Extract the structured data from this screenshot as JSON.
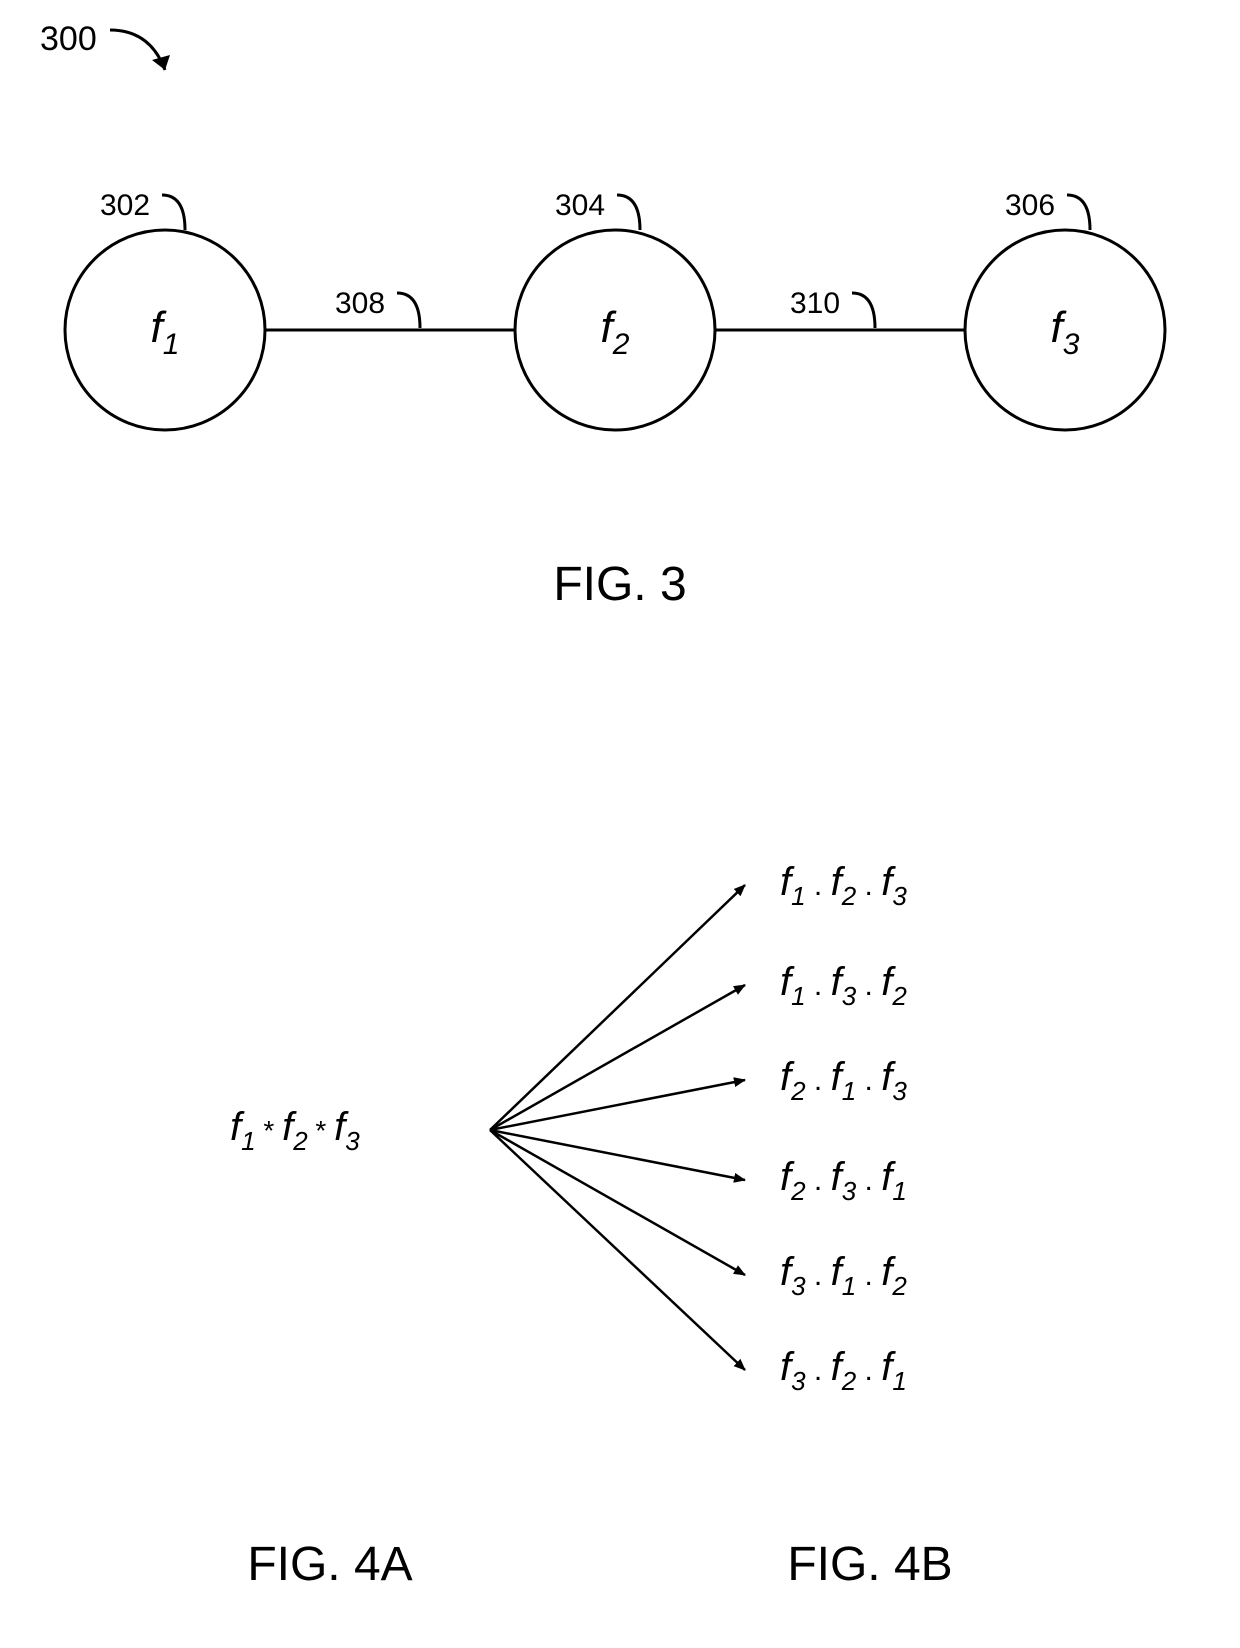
{
  "fig3": {
    "systemRef": "300",
    "nodes": [
      {
        "ref": "302",
        "label_main": "f",
        "label_sub": "1"
      },
      {
        "ref": "304",
        "label_main": "f",
        "label_sub": "2"
      },
      {
        "ref": "306",
        "label_main": "f",
        "label_sub": "3"
      }
    ],
    "edges": [
      {
        "ref": "308"
      },
      {
        "ref": "310"
      }
    ],
    "caption": "FIG. 3"
  },
  "fig4": {
    "source_tokens": [
      "f",
      "1",
      " * ",
      "f",
      "2",
      " * ",
      "f",
      "3"
    ],
    "source_display": "f₁ * f₂ * f₃",
    "permutations": [
      [
        "f",
        "1",
        " . ",
        "f",
        "2",
        " . ",
        "f",
        "3"
      ],
      [
        "f",
        "1",
        " . ",
        "f",
        "3",
        " . ",
        "f",
        "2"
      ],
      [
        "f",
        "2",
        " . ",
        "f",
        "1",
        " . ",
        "f",
        "3"
      ],
      [
        "f",
        "2",
        " . ",
        "f",
        "3",
        " . ",
        "f",
        "1"
      ],
      [
        "f",
        "3",
        " . ",
        "f",
        "1",
        " . ",
        "f",
        "2"
      ],
      [
        "f",
        "3",
        " . ",
        "f",
        "2",
        " . ",
        "f",
        "1"
      ]
    ],
    "captionA": "FIG. 4A",
    "captionB": "FIG. 4B"
  }
}
